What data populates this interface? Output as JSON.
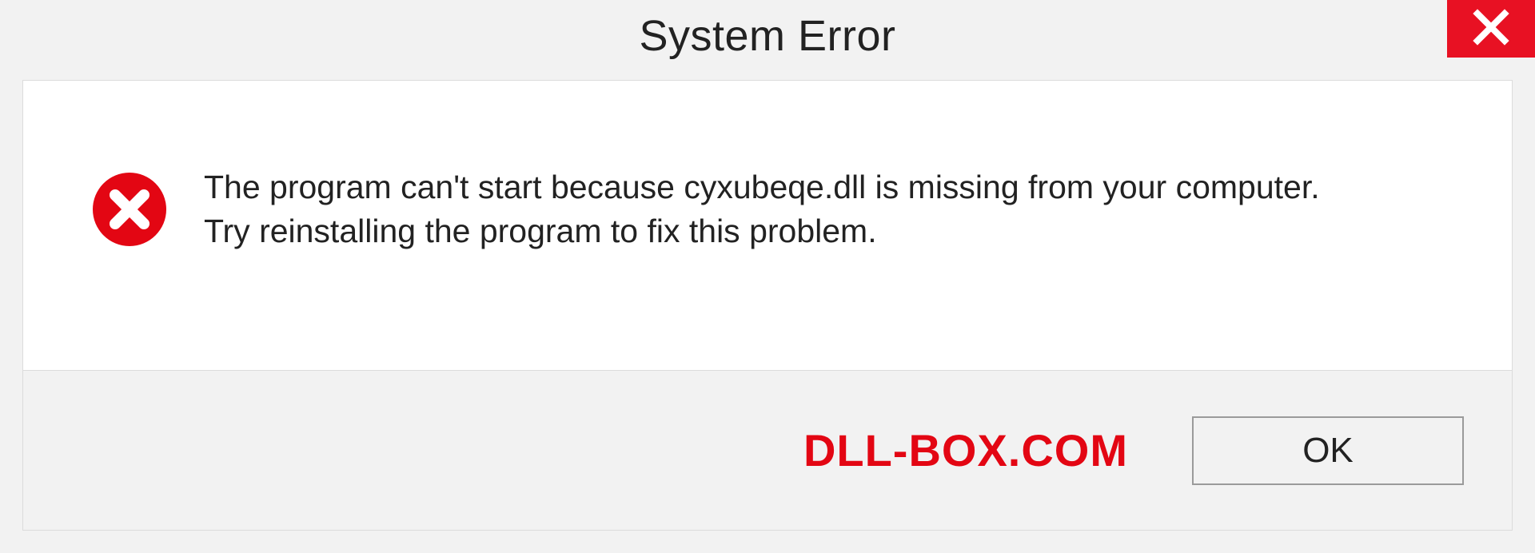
{
  "titlebar": {
    "title": "System Error"
  },
  "message": {
    "line1": "The program can't start because cyxubeqe.dll is missing from your computer.",
    "line2": "Try reinstalling the program to fix this problem."
  },
  "footer": {
    "brand": "DLL-BOX.COM",
    "ok_label": "OK"
  },
  "colors": {
    "close_bg": "#e81123",
    "error_icon": "#e30613",
    "brand_color": "#e30613"
  }
}
